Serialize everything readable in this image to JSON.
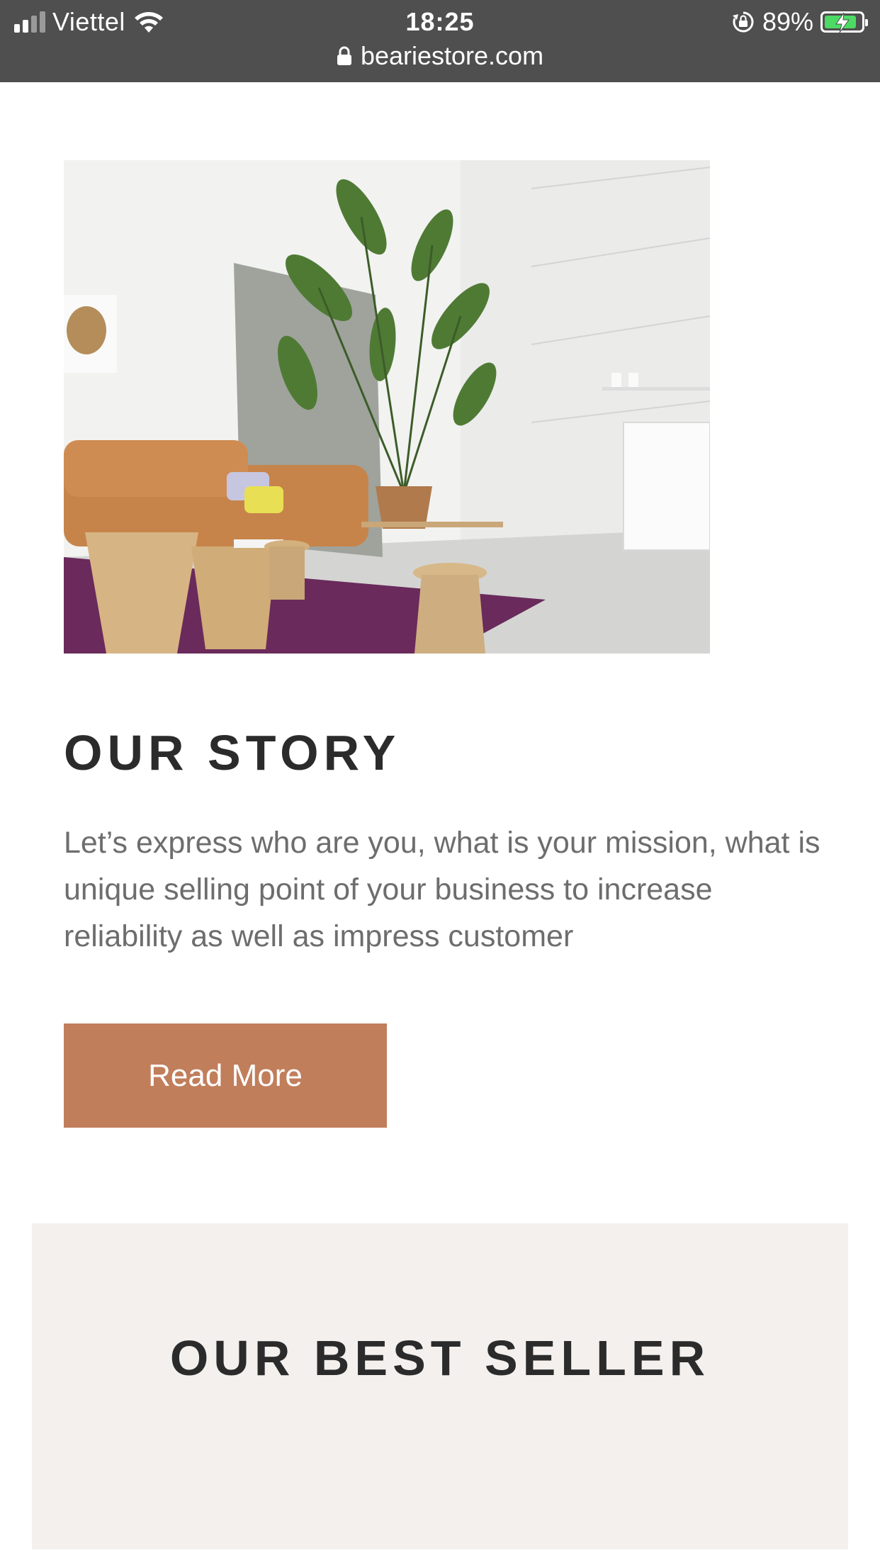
{
  "status_bar": {
    "carrier": "Viettel",
    "time": "18:25",
    "battery_percent": "89%",
    "battery_level": 0.89,
    "charging": true,
    "icons": [
      "signal-icon",
      "wifi-icon",
      "rotation-lock-icon",
      "battery-icon"
    ]
  },
  "browser": {
    "url": "beariestore.com",
    "secure_icon": "lock-icon"
  },
  "story": {
    "image_alt": "Living room interior with sofa, plants and wooden side tables",
    "title": "OUR STORY",
    "body": "Let’s express who are you, what is your mission, what is unique selling point of your business to increase reliability as well as impress customer",
    "button_label": "Read More"
  },
  "best_seller": {
    "title": "OUR BEST SELLER"
  },
  "colors": {
    "button": "#c17e5b",
    "section_bg": "#f3f0ed",
    "status_bar": "#4f4f4f",
    "heading": "#2b2b2b",
    "body_text": "#6d6d6d"
  }
}
